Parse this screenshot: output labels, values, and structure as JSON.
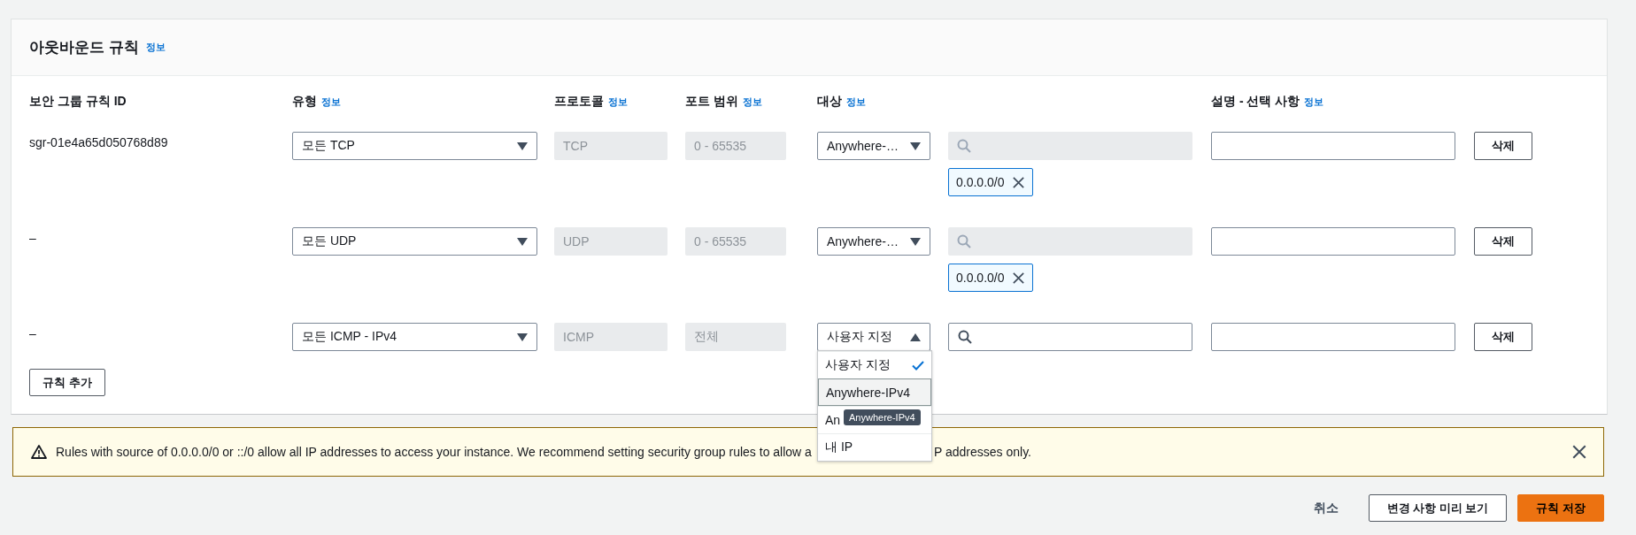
{
  "section": {
    "title": "아웃바운드 규칙",
    "info": "정보"
  },
  "columns": [
    {
      "label": "보안 그룹 규칙 ID"
    },
    {
      "label": "유형",
      "info": "정보"
    },
    {
      "label": "프로토콜",
      "info": "정보"
    },
    {
      "label": "포트 범위",
      "info": "정보"
    },
    {
      "label": "대상",
      "info": "정보"
    },
    {
      "label": "설명 - 선택 사항",
      "info": "정보"
    }
  ],
  "rows": [
    {
      "id": "sgr-01e4a65d050768d89",
      "type": "모든 TCP",
      "protocol": "TCP",
      "port_range": "0 - 65535",
      "destination": "Anywhere-…",
      "expanded": false,
      "search_disabled": true,
      "chips": [
        "0.0.0.0/0"
      ],
      "delete": "삭제"
    },
    {
      "id": "–",
      "type": "모든 UDP",
      "protocol": "UDP",
      "port_range": "0 - 65535",
      "destination": "Anywhere-…",
      "expanded": false,
      "search_disabled": true,
      "chips": [
        "0.0.0.0/0"
      ],
      "delete": "삭제"
    },
    {
      "id": "–",
      "type": "모든 ICMP - IPv4",
      "protocol": "ICMP",
      "port_range": "전체",
      "destination": "사용자 지정",
      "expanded": true,
      "search_disabled": false,
      "delete": "삭제"
    }
  ],
  "add_rule": "규칙 추가",
  "dropdown": {
    "options": [
      {
        "label": "사용자 지정",
        "selected": true,
        "hovered": false
      },
      {
        "label": "Anywhere-IPv4",
        "selected": false,
        "hovered": true
      },
      {
        "label": "An",
        "selected": false,
        "hovered": false
      },
      {
        "label": "내 IP",
        "selected": false,
        "hovered": false
      }
    ],
    "tooltip": "Anywhere-IPv4"
  },
  "warning": {
    "text_before": "Rules with source of 0.0.0.0/0 or ::/0 allow all IP addresses to access your instance. We recommend setting security group rules to allow a",
    "text_after": "P addresses only."
  },
  "footer": {
    "cancel": "취소",
    "preview": "변경 사항 미리 보기",
    "save": "규칙 저장"
  }
}
